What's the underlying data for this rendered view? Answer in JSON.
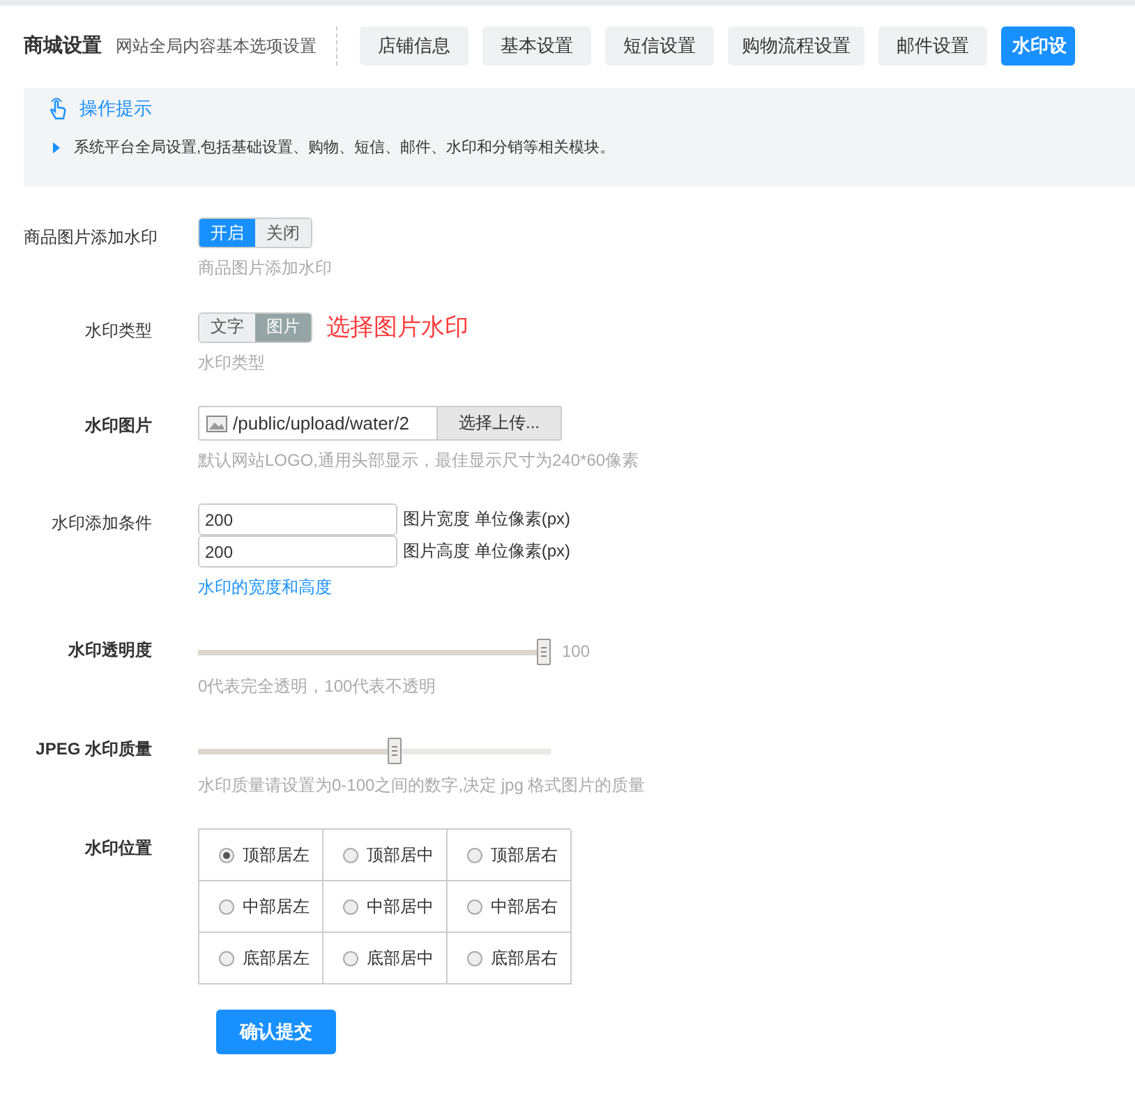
{
  "header": {
    "title": "商城设置",
    "subtitle": "网站全局内容基本选项设置",
    "tabs": [
      {
        "label": "店铺信息",
        "selected": false
      },
      {
        "label": "基本设置",
        "selected": false
      },
      {
        "label": "短信设置",
        "selected": false
      },
      {
        "label": "购物流程设置",
        "selected": false
      },
      {
        "label": "邮件设置",
        "selected": false
      },
      {
        "label": "水印设",
        "selected": true
      }
    ]
  },
  "tip": {
    "title": "操作提示",
    "items": [
      "系统平台全局设置,包括基础设置、购物、短信、邮件、水印和分销等相关模块。"
    ]
  },
  "rows": [
    {
      "kind": "toggle",
      "label": "商品图片添加水印",
      "bold": false,
      "color": "#1890ff",
      "options": [
        {
          "label": "开启",
          "selected": true
        },
        {
          "label": "关闭",
          "selected": false
        }
      ],
      "hint": "商品图片添加水印"
    },
    {
      "kind": "toggle",
      "label": "水印类型",
      "bold": false,
      "color": "#95a5a6",
      "options": [
        {
          "label": "文字",
          "selected": false
        },
        {
          "label": "图片",
          "selected": true
        }
      ],
      "note": "选择图片水印",
      "hint": "水印类型"
    },
    {
      "kind": "file",
      "label": "水印图片",
      "bold": true,
      "value": "/public/upload/water/2",
      "button": "选择上传...",
      "hint": "默认网站LOGO,通用头部显示，最佳显示尺寸为240*60像素"
    },
    {
      "kind": "size",
      "label": "水印添加条件",
      "bold": false,
      "inputs": [
        {
          "value": "200",
          "unit": "图片宽度 单位像素(px)"
        },
        {
          "value": "200",
          "unit": "图片高度 单位像素(px)"
        }
      ],
      "hint": "水印的宽度和高度"
    },
    {
      "kind": "slider",
      "label": "水印透明度",
      "bold": true,
      "level": 1,
      "reading": "100",
      "hint": "0代表完全透明，100代表不透明"
    },
    {
      "kind": "slider",
      "label": "JPEG 水印质量",
      "bold": true,
      "level": 0.56,
      "hint": "水印质量请设置为0-100之间的数字,决定 jpg 格式图片的质量"
    },
    {
      "kind": "radio-grid",
      "label": "水印位置",
      "bold": true,
      "options": [
        {
          "label": "顶部居左",
          "selected": true
        },
        {
          "label": "顶部居中",
          "selected": false
        },
        {
          "label": "顶部居右",
          "selected": false
        },
        {
          "label": "中部居左",
          "selected": false
        },
        {
          "label": "中部居中",
          "selected": false
        },
        {
          "label": "中部居右",
          "selected": false
        },
        {
          "label": "底部居左",
          "selected": false
        },
        {
          "label": "底部居中",
          "selected": false
        },
        {
          "label": "底部居右",
          "selected": false
        }
      ]
    }
  ],
  "submit": "确认提交"
}
